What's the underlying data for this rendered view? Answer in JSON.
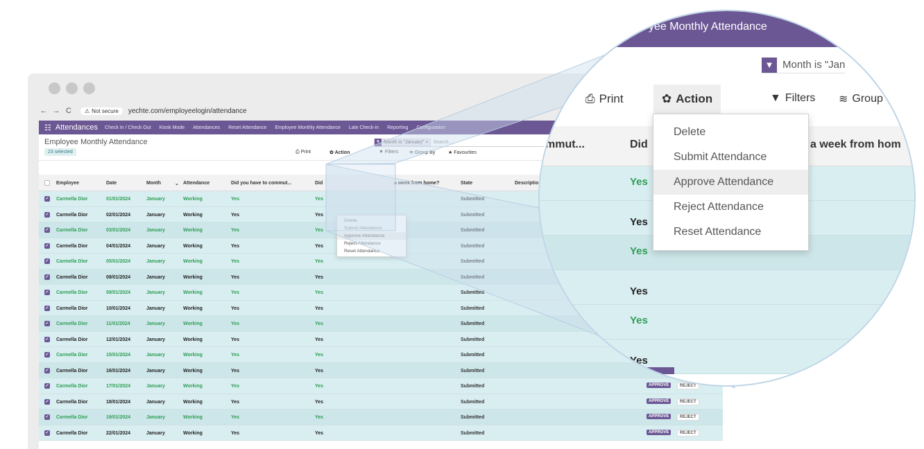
{
  "browser": {
    "nav": {
      "back": "←",
      "forward": "→",
      "reload": "C"
    },
    "security_label": "Not secure",
    "url": "yechte.com/employeelogin/attendance"
  },
  "topbar": {
    "brand": "Attendances",
    "menus": [
      "Check In / Check Out",
      "Kiosk Mode",
      "Attendances",
      "Reset Attendance",
      "Employee Monthly Attendance",
      "Late Check-in",
      "Reporting",
      "Configuration"
    ]
  },
  "control": {
    "title": "Employee Monthly Attendance",
    "selected": "23 selected",
    "filter_chip": "Month is \"January\"",
    "search_placeholder": "Search...",
    "print": "Print",
    "action": "Action",
    "filters": "Filters",
    "group_by": "Group By",
    "favourites": "Favourites"
  },
  "table": {
    "headers": {
      "employee": "Employee",
      "date": "Date",
      "month": "Month",
      "attendance": "Attendance",
      "commute": "Did you have to commut...",
      "did": "Did",
      "wfh": "a week from home?",
      "state": "State",
      "description": "Descriptio"
    },
    "rows": [
      {
        "employee": "Carmella Dior",
        "date": "01/01/2024",
        "month": "January",
        "attendance": "Working",
        "commute": "Yes",
        "did": "Yes",
        "state": "Submitted"
      },
      {
        "employee": "Carmella Dior",
        "date": "02/01/2024",
        "month": "January",
        "attendance": "Working",
        "commute": "Yes",
        "did": "Yes",
        "state": "Submitted"
      },
      {
        "employee": "Carmella Dior",
        "date": "03/01/2024",
        "month": "January",
        "attendance": "Working",
        "commute": "Yes",
        "did": "Yes",
        "state": "Submitted"
      },
      {
        "employee": "Carmella Dior",
        "date": "04/01/2024",
        "month": "January",
        "attendance": "Working",
        "commute": "Yes",
        "did": "Yes",
        "state": "Submitted"
      },
      {
        "employee": "Carmella Dior",
        "date": "05/01/2024",
        "month": "January",
        "attendance": "Working",
        "commute": "Yes",
        "did": "Yes",
        "state": "Submitted"
      },
      {
        "employee": "Carmella Dior",
        "date": "08/01/2024",
        "month": "January",
        "attendance": "Working",
        "commute": "Yes",
        "did": "Yes",
        "state": "Submitted"
      },
      {
        "employee": "Carmella Dior",
        "date": "09/01/2024",
        "month": "January",
        "attendance": "Working",
        "commute": "Yes",
        "did": "Yes",
        "state": "Submitted"
      },
      {
        "employee": "Carmella Dior",
        "date": "10/01/2024",
        "month": "January",
        "attendance": "Working",
        "commute": "Yes",
        "did": "Yes",
        "state": "Submitted"
      },
      {
        "employee": "Carmella Dior",
        "date": "11/01/2024",
        "month": "January",
        "attendance": "Working",
        "commute": "Yes",
        "did": "Yes",
        "state": "Submitted"
      },
      {
        "employee": "Carmella Dior",
        "date": "12/01/2024",
        "month": "January",
        "attendance": "Working",
        "commute": "Yes",
        "did": "Yes",
        "state": "Submitted"
      },
      {
        "employee": "Carmella Dior",
        "date": "15/01/2024",
        "month": "January",
        "attendance": "Working",
        "commute": "Yes",
        "did": "Yes",
        "state": "Submitted"
      },
      {
        "employee": "Carmella Dior",
        "date": "16/01/2024",
        "month": "January",
        "attendance": "Working",
        "commute": "Yes",
        "did": "Yes",
        "state": "Submitted"
      },
      {
        "employee": "Carmella Dior",
        "date": "17/01/2024",
        "month": "January",
        "attendance": "Working",
        "commute": "Yes",
        "did": "Yes",
        "state": "Submitted",
        "approve": "APPROVE",
        "reject": "REJECT"
      },
      {
        "employee": "Carmella Dior",
        "date": "18/01/2024",
        "month": "January",
        "attendance": "Working",
        "commute": "Yes",
        "did": "Yes",
        "state": "Submitted",
        "approve": "APPROVE",
        "reject": "REJECT"
      },
      {
        "employee": "Carmella Dior",
        "date": "19/01/2024",
        "month": "January",
        "attendance": "Working",
        "commute": "Yes",
        "did": "Yes",
        "state": "Submitted",
        "approve": "APPROVE",
        "reject": "REJECT"
      },
      {
        "employee": "Carmella Dior",
        "date": "22/01/2024",
        "month": "January",
        "attendance": "Working",
        "commute": "Yes",
        "did": "Yes",
        "state": "Submitted",
        "approve": "APPROVE",
        "reject": "REJECT"
      }
    ]
  },
  "action_menu": {
    "items": [
      "Delete",
      "Submit Attendance",
      "Approve Attendance",
      "Reject Attendance",
      "Reset Attendance"
    ],
    "highlighted": "Approve Attendance"
  },
  "magnifier": {
    "title": "yee Monthly Attendance",
    "filter_text": "Month is \"Jan",
    "print": "Print",
    "action": "Action",
    "filters": "Filters",
    "group": "Group",
    "col_commute": "mmut...",
    "col_did": "Did",
    "col_wfh": "a week from hom",
    "yes_values": [
      "Yes",
      "Yes",
      "Yes",
      "Yes",
      "Yes",
      "Yes"
    ]
  },
  "colors": {
    "brand": "#6c5795",
    "row_bg": "#d9eef1",
    "green_text": "#2e9e55"
  }
}
